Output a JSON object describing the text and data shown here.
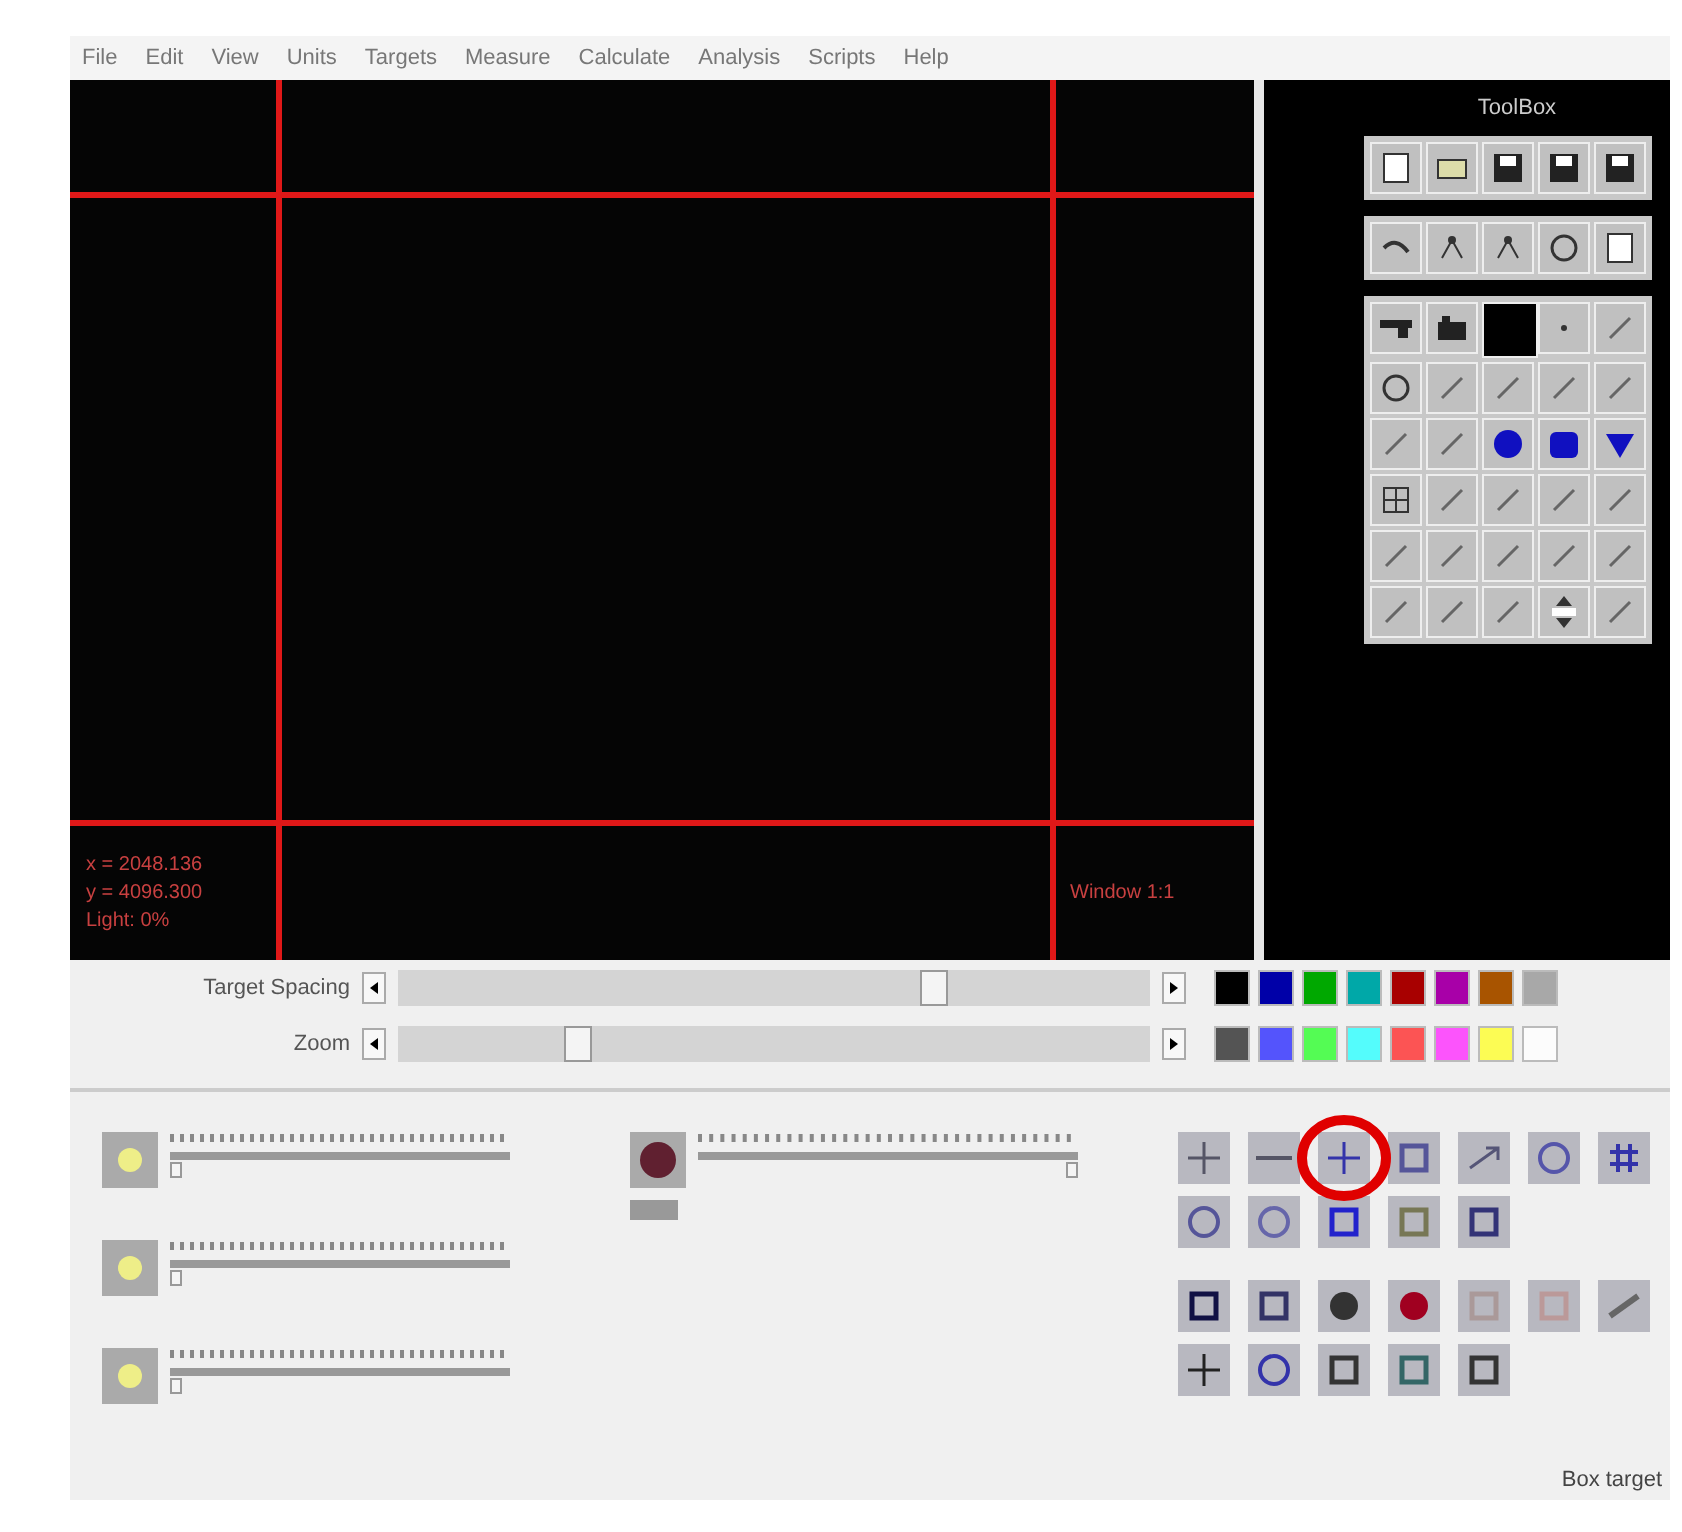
{
  "menu": [
    {
      "label": "File"
    },
    {
      "label": "Edit"
    },
    {
      "label": "View"
    },
    {
      "label": "Units"
    },
    {
      "label": "Targets"
    },
    {
      "label": "Measure"
    },
    {
      "label": "Calculate"
    },
    {
      "label": "Analysis"
    },
    {
      "label": "Scripts"
    },
    {
      "label": "Help"
    }
  ],
  "canvas": {
    "readouts": [
      "x = 2048.136",
      "y = 4096.300",
      "Light: 0%"
    ],
    "window_label": "Window 1:1"
  },
  "toolbox": {
    "title": "ToolBox"
  },
  "sliders": [
    {
      "label": "Target Spacing",
      "level": 0.72
    },
    {
      "label": "Zoom",
      "level": 0.23
    }
  ],
  "palette_rows": [
    [
      {
        "color": "#000000"
      },
      {
        "color": "#0000a8"
      },
      {
        "color": "#00a800"
      },
      {
        "color": "#00a8a8"
      },
      {
        "color": "#a80000"
      },
      {
        "color": "#a800a8"
      },
      {
        "color": "#a85400"
      },
      {
        "color": "#a8a8a8"
      }
    ],
    [
      {
        "color": "#545454"
      },
      {
        "color": "#5454fc"
      },
      {
        "color": "#54fc54"
      },
      {
        "color": "#54fcfc"
      },
      {
        "color": "#fc5454"
      },
      {
        "color": "#fc54fc"
      },
      {
        "color": "#fcfc54"
      },
      {
        "color": "#fcfcfc"
      }
    ]
  ],
  "light_sliders": [
    {
      "level": 0
    },
    {
      "level": 0
    },
    {
      "level": 0
    }
  ],
  "color_slider": {
    "level": 1
  },
  "status": "Box target"
}
